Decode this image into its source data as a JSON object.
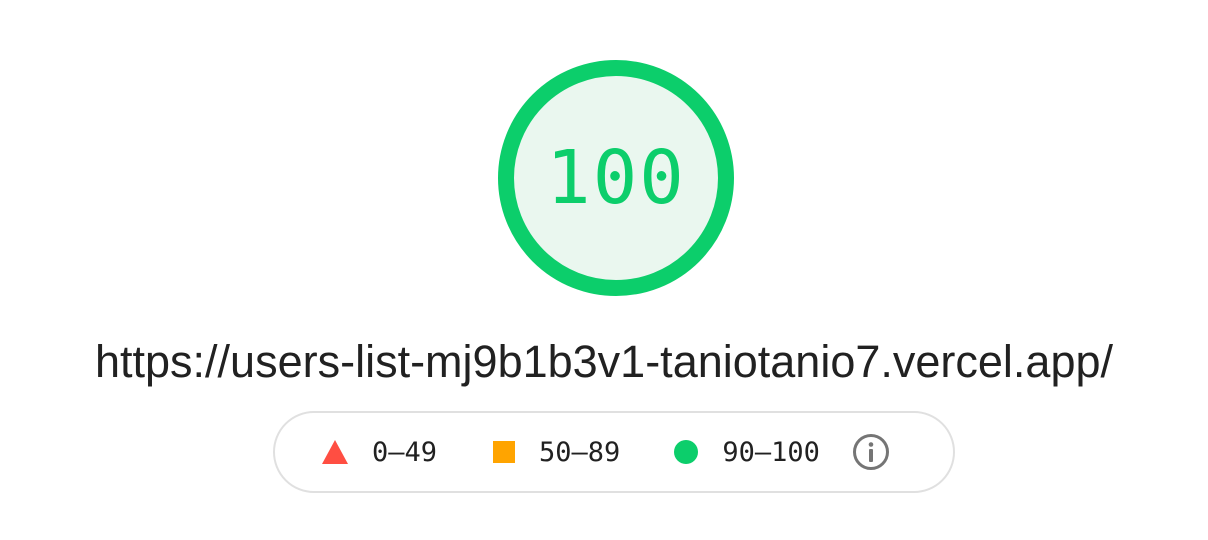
{
  "report": {
    "score": "100",
    "score_fraction": 1.0,
    "url": "https://users-list-mj9b1b3v1-taniotanio7.vercel.app/"
  },
  "legend": {
    "items": [
      {
        "label": "0–49",
        "icon": "red-triangle-icon",
        "color": "#ff4e42"
      },
      {
        "label": "50–89",
        "icon": "orange-square-icon",
        "color": "#ffa400"
      },
      {
        "label": "90–100",
        "icon": "green-circle-icon",
        "color": "#0cce6b"
      }
    ],
    "info_icon": "info-icon"
  },
  "colors": {
    "pass": "#0cce6b",
    "pass_fill": "#eaf7ef",
    "average": "#ffa400",
    "fail": "#ff4e42",
    "text": "#212121",
    "border": "#e0e0e0"
  }
}
